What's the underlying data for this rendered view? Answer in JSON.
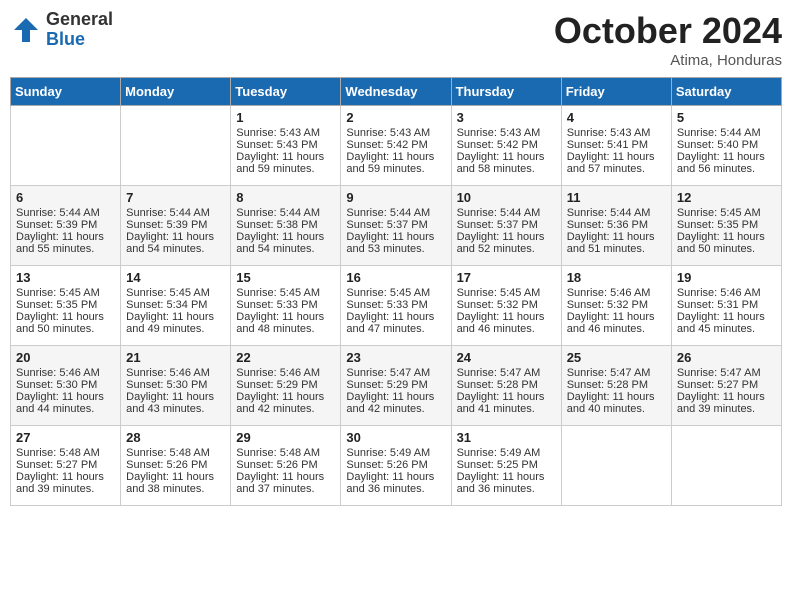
{
  "logo": {
    "general": "General",
    "blue": "Blue"
  },
  "header": {
    "month": "October 2024",
    "location": "Atima, Honduras"
  },
  "days_of_week": [
    "Sunday",
    "Monday",
    "Tuesday",
    "Wednesday",
    "Thursday",
    "Friday",
    "Saturday"
  ],
  "weeks": [
    [
      {
        "day": "",
        "sunrise": "",
        "sunset": "",
        "daylight": ""
      },
      {
        "day": "",
        "sunrise": "",
        "sunset": "",
        "daylight": ""
      },
      {
        "day": "1",
        "sunrise": "Sunrise: 5:43 AM",
        "sunset": "Sunset: 5:43 PM",
        "daylight": "Daylight: 11 hours and 59 minutes."
      },
      {
        "day": "2",
        "sunrise": "Sunrise: 5:43 AM",
        "sunset": "Sunset: 5:42 PM",
        "daylight": "Daylight: 11 hours and 59 minutes."
      },
      {
        "day": "3",
        "sunrise": "Sunrise: 5:43 AM",
        "sunset": "Sunset: 5:42 PM",
        "daylight": "Daylight: 11 hours and 58 minutes."
      },
      {
        "day": "4",
        "sunrise": "Sunrise: 5:43 AM",
        "sunset": "Sunset: 5:41 PM",
        "daylight": "Daylight: 11 hours and 57 minutes."
      },
      {
        "day": "5",
        "sunrise": "Sunrise: 5:44 AM",
        "sunset": "Sunset: 5:40 PM",
        "daylight": "Daylight: 11 hours and 56 minutes."
      }
    ],
    [
      {
        "day": "6",
        "sunrise": "Sunrise: 5:44 AM",
        "sunset": "Sunset: 5:39 PM",
        "daylight": "Daylight: 11 hours and 55 minutes."
      },
      {
        "day": "7",
        "sunrise": "Sunrise: 5:44 AM",
        "sunset": "Sunset: 5:39 PM",
        "daylight": "Daylight: 11 hours and 54 minutes."
      },
      {
        "day": "8",
        "sunrise": "Sunrise: 5:44 AM",
        "sunset": "Sunset: 5:38 PM",
        "daylight": "Daylight: 11 hours and 54 minutes."
      },
      {
        "day": "9",
        "sunrise": "Sunrise: 5:44 AM",
        "sunset": "Sunset: 5:37 PM",
        "daylight": "Daylight: 11 hours and 53 minutes."
      },
      {
        "day": "10",
        "sunrise": "Sunrise: 5:44 AM",
        "sunset": "Sunset: 5:37 PM",
        "daylight": "Daylight: 11 hours and 52 minutes."
      },
      {
        "day": "11",
        "sunrise": "Sunrise: 5:44 AM",
        "sunset": "Sunset: 5:36 PM",
        "daylight": "Daylight: 11 hours and 51 minutes."
      },
      {
        "day": "12",
        "sunrise": "Sunrise: 5:45 AM",
        "sunset": "Sunset: 5:35 PM",
        "daylight": "Daylight: 11 hours and 50 minutes."
      }
    ],
    [
      {
        "day": "13",
        "sunrise": "Sunrise: 5:45 AM",
        "sunset": "Sunset: 5:35 PM",
        "daylight": "Daylight: 11 hours and 50 minutes."
      },
      {
        "day": "14",
        "sunrise": "Sunrise: 5:45 AM",
        "sunset": "Sunset: 5:34 PM",
        "daylight": "Daylight: 11 hours and 49 minutes."
      },
      {
        "day": "15",
        "sunrise": "Sunrise: 5:45 AM",
        "sunset": "Sunset: 5:33 PM",
        "daylight": "Daylight: 11 hours and 48 minutes."
      },
      {
        "day": "16",
        "sunrise": "Sunrise: 5:45 AM",
        "sunset": "Sunset: 5:33 PM",
        "daylight": "Daylight: 11 hours and 47 minutes."
      },
      {
        "day": "17",
        "sunrise": "Sunrise: 5:45 AM",
        "sunset": "Sunset: 5:32 PM",
        "daylight": "Daylight: 11 hours and 46 minutes."
      },
      {
        "day": "18",
        "sunrise": "Sunrise: 5:46 AM",
        "sunset": "Sunset: 5:32 PM",
        "daylight": "Daylight: 11 hours and 46 minutes."
      },
      {
        "day": "19",
        "sunrise": "Sunrise: 5:46 AM",
        "sunset": "Sunset: 5:31 PM",
        "daylight": "Daylight: 11 hours and 45 minutes."
      }
    ],
    [
      {
        "day": "20",
        "sunrise": "Sunrise: 5:46 AM",
        "sunset": "Sunset: 5:30 PM",
        "daylight": "Daylight: 11 hours and 44 minutes."
      },
      {
        "day": "21",
        "sunrise": "Sunrise: 5:46 AM",
        "sunset": "Sunset: 5:30 PM",
        "daylight": "Daylight: 11 hours and 43 minutes."
      },
      {
        "day": "22",
        "sunrise": "Sunrise: 5:46 AM",
        "sunset": "Sunset: 5:29 PM",
        "daylight": "Daylight: 11 hours and 42 minutes."
      },
      {
        "day": "23",
        "sunrise": "Sunrise: 5:47 AM",
        "sunset": "Sunset: 5:29 PM",
        "daylight": "Daylight: 11 hours and 42 minutes."
      },
      {
        "day": "24",
        "sunrise": "Sunrise: 5:47 AM",
        "sunset": "Sunset: 5:28 PM",
        "daylight": "Daylight: 11 hours and 41 minutes."
      },
      {
        "day": "25",
        "sunrise": "Sunrise: 5:47 AM",
        "sunset": "Sunset: 5:28 PM",
        "daylight": "Daylight: 11 hours and 40 minutes."
      },
      {
        "day": "26",
        "sunrise": "Sunrise: 5:47 AM",
        "sunset": "Sunset: 5:27 PM",
        "daylight": "Daylight: 11 hours and 39 minutes."
      }
    ],
    [
      {
        "day": "27",
        "sunrise": "Sunrise: 5:48 AM",
        "sunset": "Sunset: 5:27 PM",
        "daylight": "Daylight: 11 hours and 39 minutes."
      },
      {
        "day": "28",
        "sunrise": "Sunrise: 5:48 AM",
        "sunset": "Sunset: 5:26 PM",
        "daylight": "Daylight: 11 hours and 38 minutes."
      },
      {
        "day": "29",
        "sunrise": "Sunrise: 5:48 AM",
        "sunset": "Sunset: 5:26 PM",
        "daylight": "Daylight: 11 hours and 37 minutes."
      },
      {
        "day": "30",
        "sunrise": "Sunrise: 5:49 AM",
        "sunset": "Sunset: 5:26 PM",
        "daylight": "Daylight: 11 hours and 36 minutes."
      },
      {
        "day": "31",
        "sunrise": "Sunrise: 5:49 AM",
        "sunset": "Sunset: 5:25 PM",
        "daylight": "Daylight: 11 hours and 36 minutes."
      },
      {
        "day": "",
        "sunrise": "",
        "sunset": "",
        "daylight": ""
      },
      {
        "day": "",
        "sunrise": "",
        "sunset": "",
        "daylight": ""
      }
    ]
  ]
}
